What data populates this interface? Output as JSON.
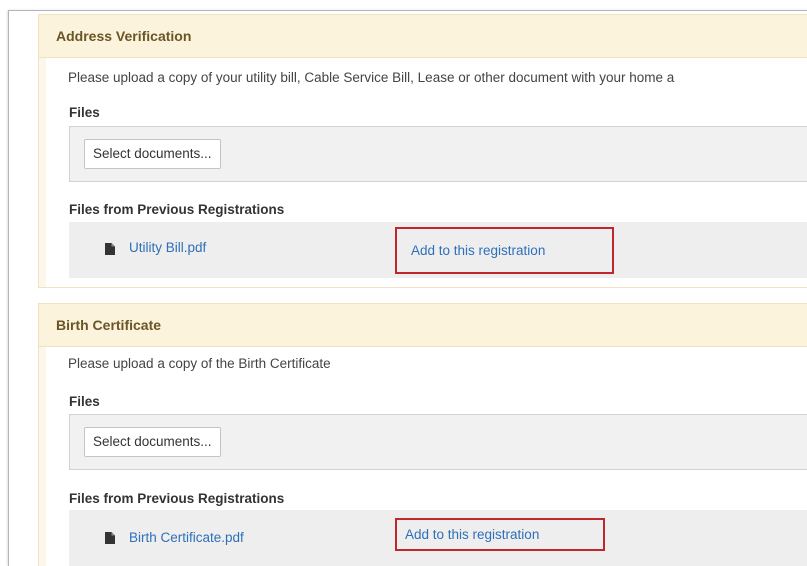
{
  "sections": [
    {
      "title": "Address Verification",
      "description": "Please upload a copy of your utility bill, Cable Service Bill, Lease or other document with your home a",
      "files_label": "Files",
      "select_button": "Select documents...",
      "previous_label": "Files from Previous Registrations",
      "previous_file": "Utility Bill.pdf",
      "add_link": "Add to this registration"
    },
    {
      "title": "Birth Certificate",
      "description": "Please upload a copy of the Birth Certificate",
      "files_label": "Files",
      "select_button": "Select documents...",
      "previous_label": "Files from Previous Registrations",
      "previous_file": "Birth Certificate.pdf",
      "add_link": "Add to this registration"
    }
  ],
  "colors": {
    "header_bg": "#fcf3dc",
    "header_text": "#6a5526",
    "link": "#2f6fba",
    "highlight_border": "#c0272d"
  }
}
